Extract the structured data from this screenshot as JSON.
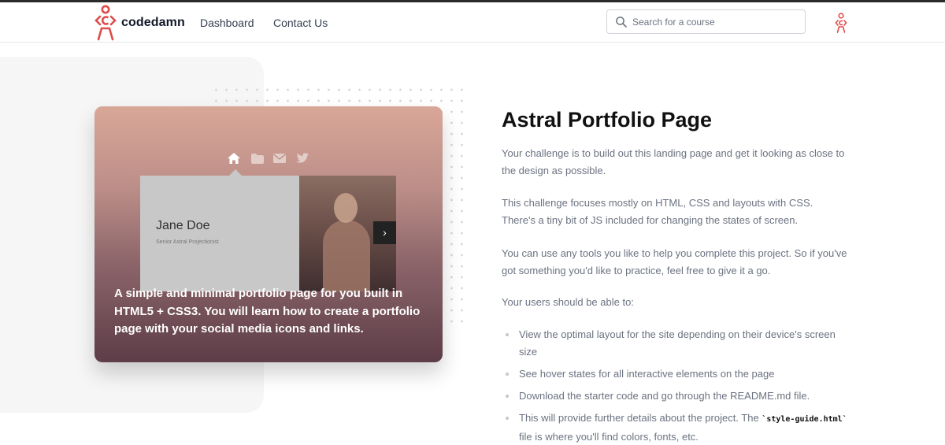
{
  "brand": {
    "name": "codedamn",
    "accent_color": "#e04b4b"
  },
  "nav": {
    "links": [
      {
        "label": "Dashboard"
      },
      {
        "label": "Contact Us"
      }
    ]
  },
  "search": {
    "placeholder": "Search for a course",
    "icon": "search-icon"
  },
  "user": {
    "icon": "user-avatar-icon"
  },
  "card": {
    "icons": [
      "home-icon",
      "folder-icon",
      "envelope-icon",
      "twitter-icon"
    ],
    "preview_name": "Jane Doe",
    "preview_subtitle": "Senior Astral Projectionist",
    "caption": "A simple and minimal portfolio page for you built in HTML5 + CSS3. You will learn how to create a portfolio page with your social media icons and links."
  },
  "content": {
    "title": "Astral Portfolio Page",
    "paragraphs": [
      "Your challenge is to build out this landing page and get it looking as close to the design as possible.",
      "This challenge focuses mostly on HTML, CSS and layouts with CSS. There's a tiny bit of JS included for changing the states of screen.",
      "You can use any tools you like to help you complete this project. So if you've got something you'd like to practice, feel free to give it a go.",
      "Your users should be able to:"
    ],
    "bullets": [
      "View the optimal layout for the site depending on their device's screen size",
      "See hover states for all interactive elements on the page",
      "Download the starter code and go through the README.md file."
    ],
    "last_bullet": {
      "before": "This will provide further details about the project. The ",
      "code": "`style-guide.html`",
      "after": " file is where you'll find colors, fonts, etc."
    }
  }
}
